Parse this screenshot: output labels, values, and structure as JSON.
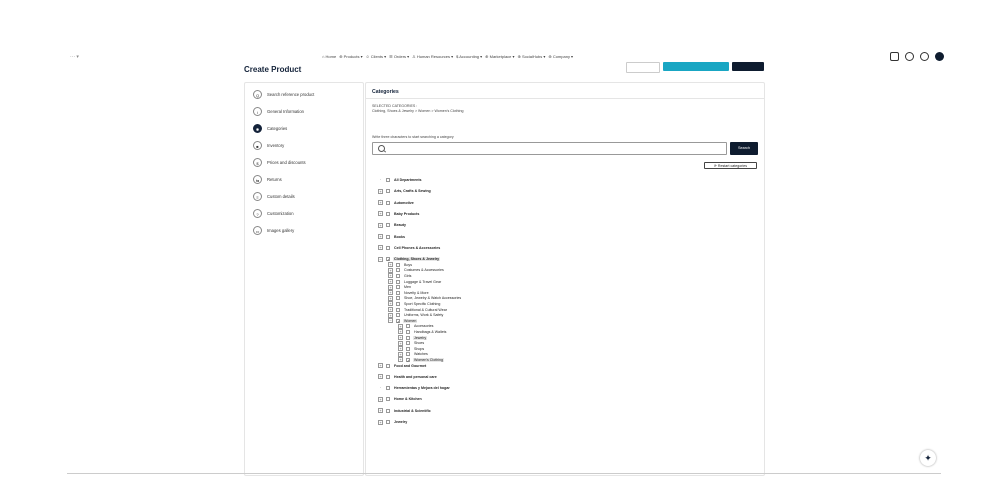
{
  "nav": {
    "logo": "···  ▾",
    "items": [
      "⌂ Home",
      "⊕ Products ▾",
      "☺ Clients ▾",
      "☰ Orders ▾",
      "♙ Human Resources ▾",
      "$ Accounting ▾",
      "⊕ Marketplace ▾",
      "⊕ SocialHubs ▾",
      "⊕ Company ▾"
    ],
    "icon_names": [
      "document-icon",
      "bell-icon",
      "help-icon",
      "user-avatar"
    ]
  },
  "page": {
    "title": "Create Product"
  },
  "steps": [
    {
      "icon": "Q",
      "label": "Search reference product"
    },
    {
      "icon": "i",
      "label": "General Information"
    },
    {
      "icon": "✱",
      "label": "Categories",
      "active": true
    },
    {
      "icon": "■",
      "label": "Inventory"
    },
    {
      "icon": "$",
      "label": "Prices and discounts"
    },
    {
      "icon": "⇆",
      "label": "Returns"
    },
    {
      "icon": "≡",
      "label": "Custom details"
    },
    {
      "icon": "?",
      "label": "Customization"
    },
    {
      "icon": "▭",
      "label": "Images gallery"
    }
  ],
  "categories": {
    "title": "Categories",
    "selected_label": "SELECTED CATEGORIES :",
    "selected_value": "Clothing, Shoes & Jewelry > Women > Women's Clothing",
    "hint": "Write three characters to start searching a category",
    "search_button": "Search",
    "restart_button": "⟳ Restart categories",
    "tree": [
      {
        "label": "All Departments",
        "level": 0,
        "toggle": "none"
      },
      {
        "label": "Arts, Crafts & Sewing",
        "level": 0,
        "toggle": "+"
      },
      {
        "label": "Automotive",
        "level": 0,
        "toggle": "+"
      },
      {
        "label": "Baby Products",
        "level": 0,
        "toggle": "+"
      },
      {
        "label": "Beauty",
        "level": 0,
        "toggle": "+"
      },
      {
        "label": "Books",
        "level": 0,
        "toggle": "+"
      },
      {
        "label": "Cell Phones & Accessories",
        "level": 0,
        "toggle": "+"
      },
      {
        "label": "Clothing, Shoes & Jewelry",
        "level": 0,
        "toggle": "−",
        "checked": true,
        "highlight": true
      },
      {
        "label": "Boys",
        "level": 1,
        "toggle": "+"
      },
      {
        "label": "Costumes & Accessories",
        "level": 1,
        "toggle": "+"
      },
      {
        "label": "Girls",
        "level": 1,
        "toggle": "+"
      },
      {
        "label": "Luggage & Travel Gear",
        "level": 1,
        "toggle": "+"
      },
      {
        "label": "Men",
        "level": 1,
        "toggle": "+"
      },
      {
        "label": "Novelty & More",
        "level": 1,
        "toggle": "+"
      },
      {
        "label": "Shoe, Jewelry & Watch Accessories",
        "level": 1,
        "toggle": "+"
      },
      {
        "label": "Sport Specific Clothing",
        "level": 1,
        "toggle": "+"
      },
      {
        "label": "Traditional & Cultural Wear",
        "level": 1,
        "toggle": "+"
      },
      {
        "label": "Uniforms, Work & Safety",
        "level": 1,
        "toggle": "+"
      },
      {
        "label": "Women",
        "level": 1,
        "toggle": "−",
        "checked": true,
        "highlight": true
      },
      {
        "label": "Accessories",
        "level": 2,
        "toggle": "+"
      },
      {
        "label": "Handbags & Wallets",
        "level": 2,
        "toggle": "+"
      },
      {
        "label": "Jewelry",
        "level": 2,
        "toggle": "+",
        "highlight": true
      },
      {
        "label": "Shoes",
        "level": 2,
        "toggle": "+"
      },
      {
        "label": "Shops",
        "level": 2,
        "toggle": "+"
      },
      {
        "label": "Watches",
        "level": 2,
        "toggle": "+"
      },
      {
        "label": "Women's Clothing",
        "level": 2,
        "toggle": "+",
        "checked": true,
        "highlight": true
      },
      {
        "label": "Food and Gourmet",
        "level": 0,
        "toggle": "+"
      },
      {
        "label": "Health and personal care",
        "level": 0,
        "toggle": "+"
      },
      {
        "label": "Herramientas y Mejora del hogar",
        "level": 0,
        "toggle": "none"
      },
      {
        "label": "Home & Kitchen",
        "level": 0,
        "toggle": "+"
      },
      {
        "label": "Industrial & Scientific",
        "level": 0,
        "toggle": "+"
      },
      {
        "label": "Jewelry",
        "level": 0,
        "toggle": "+"
      }
    ]
  },
  "fab": {
    "icon": "✦"
  }
}
